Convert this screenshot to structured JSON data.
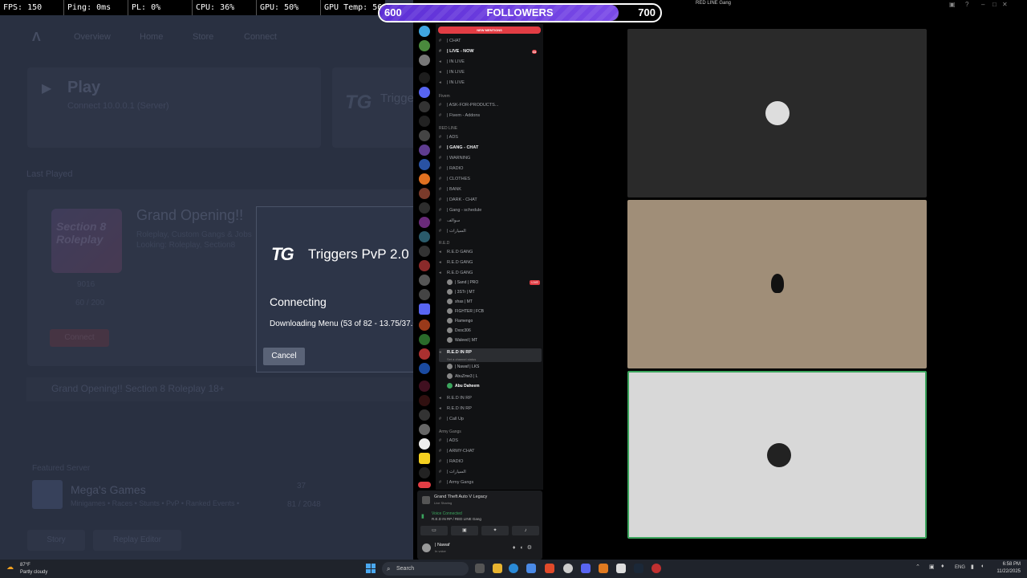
{
  "launcher": {
    "nav": [
      "Overview",
      "Home",
      "Store",
      "Connect"
    ],
    "play_title": "Play",
    "play_sub": "Connect 10.0.0.1 (Server)",
    "triggers_short": "Trigge",
    "section_label": "Last Played",
    "art_text": "Section 8 Roleplay",
    "server_title": "Grand Opening!!",
    "server_sub": "Roleplay, Custom Gangs & Jobs Looking: Roleplay, Section8",
    "stat_ping": "9016",
    "stat_players": "60 / 200",
    "btn_connect": "Connect",
    "banner": "Grand Opening!! Section 8 Roleplay 18+",
    "featured_label": "Featured Server",
    "mega_title": "Mega's Games",
    "mega_sub": "Minigames • Races • Stunts • PvP • Ranked Events •",
    "mega_count": "37",
    "mega_players": "81 / 2048",
    "btn_story": "Story",
    "btn_replay": "Replay Editor"
  },
  "stats": {
    "fps": "FPS: 150",
    "ping": "Ping: 0ms",
    "pl": "PL: 0%",
    "cpu": "CPU: 36%",
    "gpu": "GPU: 50%",
    "gpu_temp": "GPU Temp: 56"
  },
  "followers": {
    "label": "FOLLOWERS",
    "current": "600",
    "goal": "700",
    "progress": 0.85
  },
  "dialog": {
    "logo": "TG",
    "title": "Triggers PvP 2.0",
    "status": "Connecting",
    "detail": "Downloading Menu (53 of 82 - 13.75/37.0",
    "cancel": "Cancel"
  },
  "discord": {
    "window_title": "RED LINE Gang",
    "new_mentions": "NEW MENTIONS",
    "channels": [
      {
        "name": "| CHAT",
        "bold": false
      },
      {
        "name": "| LIVE - NOW",
        "bold": true,
        "badge": "33"
      },
      {
        "name": "| IN LIVE",
        "bold": false
      },
      {
        "name": "| IN LIVE",
        "bold": false
      },
      {
        "name": "| IN LIVE",
        "bold": false
      }
    ],
    "cat_fivem": "Fivem",
    "fivem_channels": [
      "| ASK-FOR-PRODUCTS...",
      "| Fivem - Addons"
    ],
    "cat_redline": "RED LINE",
    "redline_channels": [
      {
        "name": "| ADS",
        "bold": false
      },
      {
        "name": "| GANG - CHAT",
        "bold": true
      },
      {
        "name": "| WARNING",
        "bold": false
      },
      {
        "name": "| RADIO",
        "bold": false
      },
      {
        "name": "| CLOTHES",
        "bold": false
      },
      {
        "name": "| BANK",
        "bold": false
      },
      {
        "name": "| DARK - CHAT",
        "bold": false
      },
      {
        "name": "| Gang - schedule",
        "bold": false
      },
      {
        "name": "سوالف",
        "bold": false
      },
      {
        "name": "| السيارات",
        "bold": false
      }
    ],
    "cat_red": "R.E.D",
    "red_voice": [
      "R.E.D GANG",
      "R.E.D GANG",
      "R.E.D GANG"
    ],
    "red_users": [
      "| Sand | PRO",
      "| 3STr | MT",
      "shas | MT",
      "FIGHTER | FCB",
      "Flamengo",
      "Dxoc306",
      "Waleed | MT"
    ],
    "live_tag": "LIVE",
    "rp_channel": "R.E.D IN RP",
    "rp_sub": "Set a channel status",
    "rp_users": [
      "| Nawaf | LKS",
      "AbuZme3 | L",
      "Abu Daheem"
    ],
    "rp_voice": [
      "R.E.D IN RP",
      "R.E.D IN RP",
      "| Call Up"
    ],
    "cat_army": "Army Gangs",
    "army_channels": [
      "| ADS",
      "| ARMY-CHAT",
      "| RADIO",
      "| السيارات",
      "| Army Gangs"
    ],
    "game_name": "Grand Theft Auto V Legacy",
    "game_sub": "Live Sharing",
    "voice_connected": "Voice Connected",
    "voice_channel": "R.E.D IN RP / RED LINE Gang",
    "user_name": "| Nawaf",
    "user_status": "In voice",
    "colors": {
      "live": "#e23d44",
      "connected": "#3ba55d"
    }
  },
  "taskbar": {
    "temp": "87°F",
    "weather": "Partly cloudy",
    "search": "Search",
    "lang": "ENG",
    "time": "6:58 PM",
    "date": "11/22/2025"
  }
}
